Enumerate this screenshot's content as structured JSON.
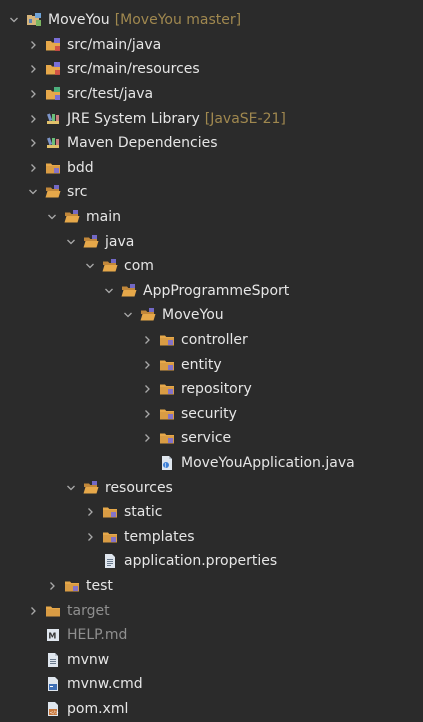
{
  "tree": [
    {
      "label": "MoveYou",
      "deco": "[MoveYou master]",
      "depth": 0,
      "chevron": "down",
      "icon": "project-icon",
      "muted": false
    },
    {
      "label": "src/main/java",
      "depth": 1,
      "chevron": "right",
      "icon": "source-folder-icon",
      "muted": false
    },
    {
      "label": "src/main/resources",
      "depth": 1,
      "chevron": "right",
      "icon": "source-folder-icon",
      "muted": false
    },
    {
      "label": "src/test/java",
      "depth": 1,
      "chevron": "right",
      "icon": "test-source-folder-icon",
      "muted": false
    },
    {
      "label": "JRE System Library",
      "deco": "[JavaSE-21]",
      "depth": 1,
      "chevron": "right",
      "icon": "library-icon",
      "muted": false
    },
    {
      "label": "Maven Dependencies",
      "depth": 1,
      "chevron": "right",
      "icon": "library-icon",
      "muted": false
    },
    {
      "label": "bdd",
      "depth": 1,
      "chevron": "right",
      "icon": "folder-icon",
      "muted": false
    },
    {
      "label": "src",
      "depth": 1,
      "chevron": "down",
      "icon": "folder-open-icon",
      "muted": false
    },
    {
      "label": "main",
      "depth": 2,
      "chevron": "down",
      "icon": "folder-open-icon",
      "muted": false
    },
    {
      "label": "java",
      "depth": 3,
      "chevron": "down",
      "icon": "folder-open-icon",
      "muted": false
    },
    {
      "label": "com",
      "depth": 4,
      "chevron": "down",
      "icon": "folder-open-icon",
      "muted": false
    },
    {
      "label": "AppProgrammeSport",
      "depth": 5,
      "chevron": "down",
      "icon": "folder-open-icon",
      "muted": false
    },
    {
      "label": "MoveYou",
      "depth": 6,
      "chevron": "down",
      "icon": "folder-open-icon",
      "muted": false
    },
    {
      "label": "controller",
      "depth": 7,
      "chevron": "right",
      "icon": "folder-icon",
      "muted": false
    },
    {
      "label": "entity",
      "depth": 7,
      "chevron": "right",
      "icon": "folder-icon",
      "muted": false
    },
    {
      "label": "repository",
      "depth": 7,
      "chevron": "right",
      "icon": "folder-icon",
      "muted": false
    },
    {
      "label": "security",
      "depth": 7,
      "chevron": "right",
      "icon": "folder-icon",
      "muted": false
    },
    {
      "label": "service",
      "depth": 7,
      "chevron": "right",
      "icon": "folder-icon",
      "muted": false
    },
    {
      "label": "MoveYouApplication.java",
      "depth": 7,
      "chevron": "none",
      "icon": "java-file-icon",
      "muted": false
    },
    {
      "label": "resources",
      "depth": 3,
      "chevron": "down",
      "icon": "folder-open-icon",
      "muted": false
    },
    {
      "label": "static",
      "depth": 4,
      "chevron": "right",
      "icon": "folder-icon",
      "muted": false
    },
    {
      "label": "templates",
      "depth": 4,
      "chevron": "right",
      "icon": "folder-icon",
      "muted": false
    },
    {
      "label": "application.properties",
      "depth": 4,
      "chevron": "none",
      "icon": "properties-file-icon",
      "muted": false
    },
    {
      "label": "test",
      "depth": 2,
      "chevron": "right",
      "icon": "folder-icon",
      "muted": false
    },
    {
      "label": "target",
      "depth": 1,
      "chevron": "right",
      "icon": "target-folder-icon",
      "muted": true
    },
    {
      "label": "HELP.md",
      "depth": 1,
      "chevron": "none",
      "icon": "markdown-file-icon",
      "muted": true
    },
    {
      "label": "mvnw",
      "depth": 1,
      "chevron": "none",
      "icon": "file-icon",
      "muted": false
    },
    {
      "label": "mvnw.cmd",
      "depth": 1,
      "chevron": "none",
      "icon": "cmd-file-icon",
      "muted": false
    },
    {
      "label": "pom.xml",
      "depth": 1,
      "chevron": "none",
      "icon": "xml-file-icon",
      "muted": false
    }
  ],
  "colors": {
    "background": "#2b2b2b",
    "text": "#e6e6e6",
    "decoration": "#a0884f",
    "muted": "#8f8f8f",
    "folder": "#e6a84a",
    "chevron": "#a9a9a9"
  }
}
